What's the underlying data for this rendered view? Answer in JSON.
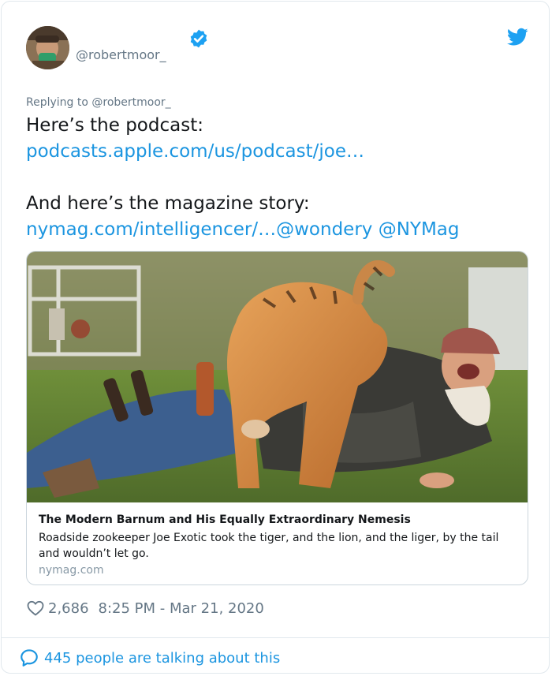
{
  "tweet": {
    "author_handle": "@robertmoor_",
    "icons": {
      "verified": "verified-badge-icon",
      "brand": "twitter-bird-icon",
      "like": "heart-icon",
      "reply": "speech-bubble-icon"
    },
    "colors": {
      "link": "#1b95e0",
      "text": "#14171a",
      "muted": "#657786",
      "border": "#e1e8ed"
    },
    "replying_to": "Replying to @robertmoor_",
    "text": {
      "line1": "Here’s the podcast:",
      "link1": "podcasts.apple.com/us/podcast/joe…",
      "line2": "And here’s the magazine story:",
      "link2": "nymag.com/intelligencer/…",
      "mention1": "@wondery",
      "mention2": "@NYMag"
    },
    "card": {
      "title": "The Modern Barnum and His Equally Extraordinary Nemesis",
      "description": "Roadside zookeeper Joe Exotic took the tiger, and the lion, and the liger, by the tail and wouldn’t let go.",
      "domain": "nymag.com"
    },
    "like_count": "2,686",
    "timestamp": "8:25 PM - Mar 21, 2020",
    "talking_about": "445 people are talking about this"
  }
}
